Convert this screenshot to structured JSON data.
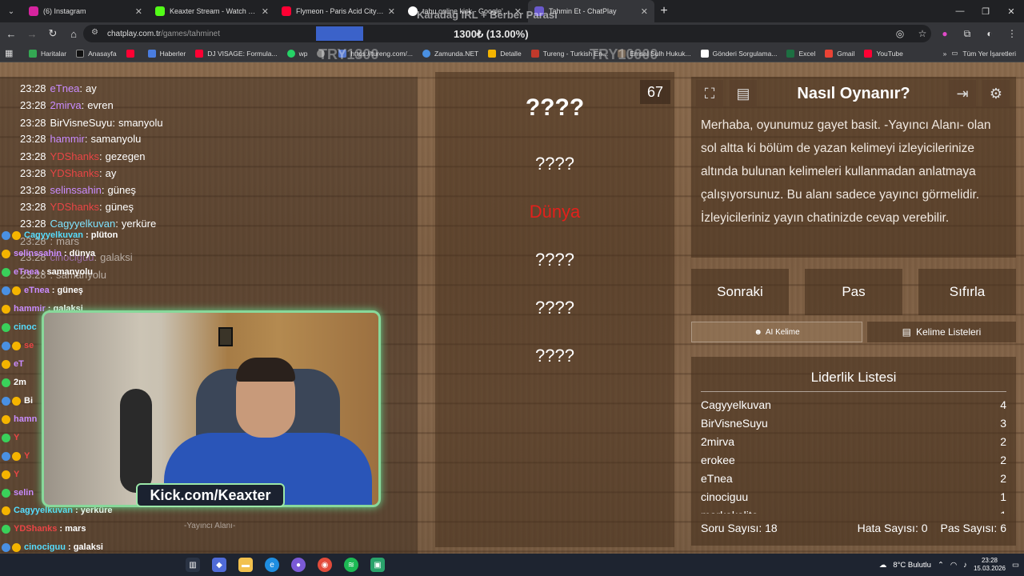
{
  "tabs": [
    {
      "title": "(6) Instagram",
      "color": "#d6249f"
    },
    {
      "title": "Keaxter Stream - Watch Live on",
      "color": "#53fc18"
    },
    {
      "title": "Flymeon - Paris Acid City (Offic",
      "color": "#ff0033"
    },
    {
      "title": "tabu online kick - Google'da A",
      "color": "#ffffff"
    },
    {
      "title": "Tahmin Et - ChatPlay",
      "color": "#6a5acd"
    }
  ],
  "address": {
    "domain": "chatplay.com.tr",
    "path": "/games/tahminet"
  },
  "stream_overlay": {
    "title": "Karadag IRL + Berber Parası",
    "progress_text": "1300₺ (13.00%)",
    "progress_fraction": 0.13,
    "ghost1": "TRY1300",
    "ghost2": "TRY10000"
  },
  "bookmarks": [
    "Haritalar",
    "Anasayfa",
    "Haberler",
    "DJ VISAGE: Formula...",
    "wp",
    "",
    "https://tureng.com/...",
    "Zamunda.NET",
    "Detalle",
    "Tureng - Turkish En...",
    "Emsal Sulh Hukuk...",
    "Gönderi Sorgulama...",
    "Excel",
    "Gmail",
    "YouTube"
  ],
  "bookmarks_right": "Tüm Yer İşaretleri",
  "chat": [
    {
      "time": "23:28",
      "user": "eTnea",
      "color": "#c98cff",
      "msg": "ay"
    },
    {
      "time": "23:28",
      "user": "2mirva",
      "color": "#c98cff",
      "msg": "evren"
    },
    {
      "time": "23:28",
      "user": "BirVisneSuyu",
      "color": "#ffffff",
      "msg": "smanyolu"
    },
    {
      "time": "23:28",
      "user": "hammir",
      "color": "#c98cff",
      "msg": "samanyolu"
    },
    {
      "time": "23:28",
      "user": "YDShanks",
      "color": "#e84545",
      "msg": "gezegen"
    },
    {
      "time": "23:28",
      "user": "YDShanks",
      "color": "#e84545",
      "msg": "ay"
    },
    {
      "time": "23:28",
      "user": "selinssahin",
      "color": "#c98cff",
      "msg": "güneş"
    },
    {
      "time": "23:28",
      "user": "YDShanks",
      "color": "#e84545",
      "msg": "güneş"
    },
    {
      "time": "23:28",
      "user": "Cagyyelkuvan",
      "color": "#7fe3ff",
      "msg": "yerküre"
    },
    {
      "time": "23:28",
      "user": "",
      "color": "#c98cff",
      "msg": "mars"
    },
    {
      "time": "23:28",
      "user": "cinociguu",
      "color": "#c98cff",
      "msg": "galaksi"
    },
    {
      "time": "23:28",
      "user": "",
      "color": "#c98cff",
      "msg": "samanyolu"
    }
  ],
  "overlay_chat": [
    {
      "user": "Cagyyelkuvan",
      "color": "#55ddff",
      "msg": "plüton"
    },
    {
      "user": "selinssahin",
      "color": "#c98cff",
      "msg": "dünya"
    },
    {
      "user": "eTnea",
      "color": "#c98cff",
      "msg": "samanyolu"
    },
    {
      "user": "eTnea",
      "color": "#c98cff",
      "msg": "güneş"
    },
    {
      "user": "hammir",
      "color": "#c98cff",
      "msg": "galaksi"
    },
    {
      "user": "cinoc",
      "color": "#55ddff",
      "msg": ""
    },
    {
      "user": "se",
      "color": "#e84545",
      "msg": ""
    },
    {
      "user": "eT",
      "color": "#c98cff",
      "msg": ""
    },
    {
      "user": "2m",
      "color": "#ffffff",
      "msg": ""
    },
    {
      "user": "Bi",
      "color": "#ffffff",
      "msg": ""
    },
    {
      "user": "hamn",
      "color": "#c98cff",
      "msg": ""
    },
    {
      "user": "Y",
      "color": "#e84545",
      "msg": ""
    },
    {
      "user": "Y",
      "color": "#e84545",
      "msg": ""
    },
    {
      "user": "Y",
      "color": "#e84545",
      "msg": ""
    },
    {
      "user": "selin",
      "color": "#c98cff",
      "msg": ""
    },
    {
      "user": "Y",
      "color": "#e84545",
      "msg": ""
    },
    {
      "user": "Cagyyelkuvan",
      "color": "#55ddff",
      "msg": "yerküre"
    },
    {
      "user": "YDShanks",
      "color": "#e84545",
      "msg": "mars"
    },
    {
      "user": "cinociguu",
      "color": "#55ddff",
      "msg": "galaksi"
    },
    {
      "user": "BirVisneSuyu",
      "color": "#c98cff",
      "msg": "samanyolu"
    }
  ],
  "cam_label": "Kick.com/Keaxter",
  "yayinci_label": "-Yayıncı Alanı-",
  "timer": "67",
  "words": [
    "????",
    "????",
    "Dünya",
    "????",
    "????",
    "????"
  ],
  "help": {
    "title": "Nasıl Oynanır?",
    "text": "Merhaba, oyunumuz gayet basit. -Yayıncı Alanı- olan sol altta ki bölüm de yazan kelimeyi izleyicilerinize altında bulunan kelimeleri kullanmadan anlatmaya çalışıyorsunuz. Bu alanı sadece yayıncı görmelidir. İzleyicileriniz yayın chatinizde cevap verebilir."
  },
  "actions": {
    "next": "Sonraki",
    "pass": "Pas",
    "reset": "Sıfırla",
    "ai": "AI Kelime",
    "lists": "Kelime Listeleri"
  },
  "leaderboard": {
    "title": "Liderlik Listesi",
    "rows": [
      {
        "name": "Cagyyelkuvan",
        "score": "4"
      },
      {
        "name": "BirVisneSuyu",
        "score": "3"
      },
      {
        "name": "2mirva",
        "score": "2"
      },
      {
        "name": "erokee",
        "score": "2"
      },
      {
        "name": "eTnea",
        "score": "2"
      },
      {
        "name": "cinociguu",
        "score": "1"
      },
      {
        "name": "markakalite",
        "score": "1"
      }
    ],
    "questions": "Soru Sayısı: 18",
    "errors": "Hata Sayısı: 0",
    "passes": "Pas Sayısı: 6"
  },
  "taskbar": {
    "weather": "8°C Bulutlu",
    "time": "23:28",
    "date": "15.03.2026"
  }
}
